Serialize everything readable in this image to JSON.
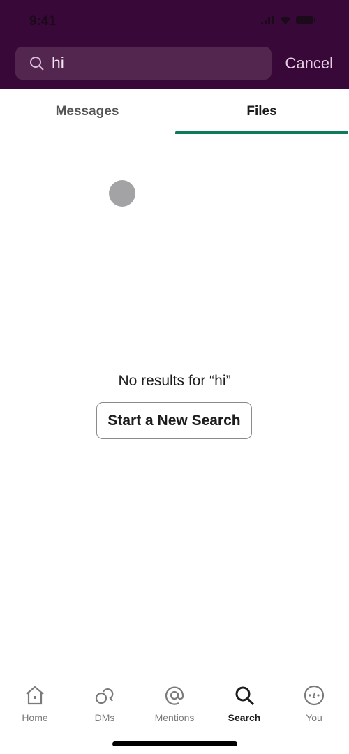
{
  "status_bar": {
    "time": "9:41"
  },
  "search": {
    "query": "hi",
    "cancel_label": "Cancel"
  },
  "tabs": [
    {
      "label": "Messages",
      "active": false
    },
    {
      "label": "Files",
      "active": true
    }
  ],
  "empty_state": {
    "message": "No results for “hi”",
    "button_label": "Start a New Search"
  },
  "nav": [
    {
      "label": "Home",
      "icon": "home-icon"
    },
    {
      "label": "DMs",
      "icon": "dms-icon"
    },
    {
      "label": "Mentions",
      "icon": "at-icon"
    },
    {
      "label": "Search",
      "icon": "search-icon",
      "active": true
    },
    {
      "label": "You",
      "icon": "you-icon"
    }
  ],
  "colors": {
    "header": "#370838",
    "accent": "#107a5c"
  }
}
